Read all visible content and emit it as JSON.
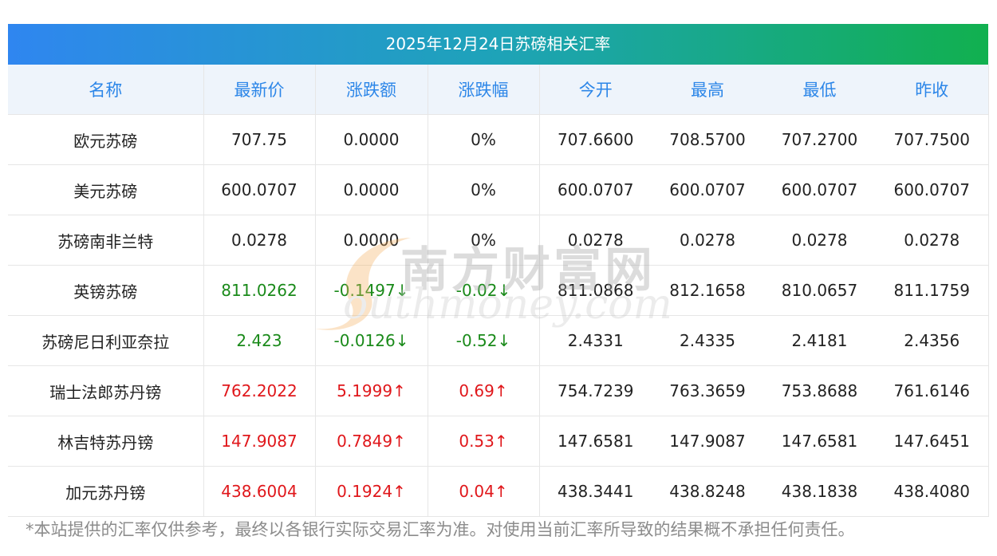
{
  "title": "2025年12月24日苏磅相关汇率",
  "headers": [
    "名称",
    "最新价",
    "涨跌额",
    "涨跌幅",
    "今开",
    "最高",
    "最低",
    "昨收"
  ],
  "rows": [
    {
      "name": "欧元苏磅",
      "latest": "707.75",
      "change": "0.0000",
      "pct": "0%",
      "open": "707.6600",
      "high": "708.5700",
      "low": "707.2700",
      "prev": "707.7500",
      "trend": "flat"
    },
    {
      "name": "美元苏磅",
      "latest": "600.0707",
      "change": "0.0000",
      "pct": "0%",
      "open": "600.0707",
      "high": "600.0707",
      "low": "600.0707",
      "prev": "600.0707",
      "trend": "flat"
    },
    {
      "name": "苏磅南非兰特",
      "latest": "0.0278",
      "change": "0.0000",
      "pct": "0%",
      "open": "0.0278",
      "high": "0.0278",
      "low": "0.0278",
      "prev": "0.0278",
      "trend": "flat"
    },
    {
      "name": "英镑苏磅",
      "latest": "811.0262",
      "change": "-0.1497↓",
      "pct": "-0.02↓",
      "open": "811.0868",
      "high": "812.1658",
      "low": "810.0657",
      "prev": "811.1759",
      "trend": "down"
    },
    {
      "name": "苏磅尼日利亚奈拉",
      "latest": "2.423",
      "change": "-0.0126↓",
      "pct": "-0.52↓",
      "open": "2.4331",
      "high": "2.4335",
      "low": "2.4181",
      "prev": "2.4356",
      "trend": "down"
    },
    {
      "name": "瑞士法郎苏丹镑",
      "latest": "762.2022",
      "change": "5.1999↑",
      "pct": "0.69↑",
      "open": "754.7239",
      "high": "763.3659",
      "low": "753.8688",
      "prev": "761.6146",
      "trend": "up"
    },
    {
      "name": "林吉特苏丹镑",
      "latest": "147.9087",
      "change": "0.7849↑",
      "pct": "0.53↑",
      "open": "147.6581",
      "high": "147.9087",
      "low": "147.6581",
      "prev": "147.6451",
      "trend": "up"
    },
    {
      "name": "加元苏丹镑",
      "latest": "438.6004",
      "change": "0.1924↑",
      "pct": "0.04↑",
      "open": "438.3441",
      "high": "438.8248",
      "low": "438.1838",
      "prev": "438.4080",
      "trend": "up"
    }
  ],
  "watermark": {
    "cn": "南方财富网",
    "en": "outhmoney.com"
  },
  "footnote": "*本站提供的汇率仅供参考，最终以各银行实际交易汇率为准。对使用当前汇率所导致的结果概不承担任何责任。",
  "colors": {
    "up": "#e0171b",
    "down": "#1a8a1a",
    "header_text": "#2c86e8",
    "gradient_start": "#2f86f0",
    "gradient_end": "#11b04f"
  }
}
